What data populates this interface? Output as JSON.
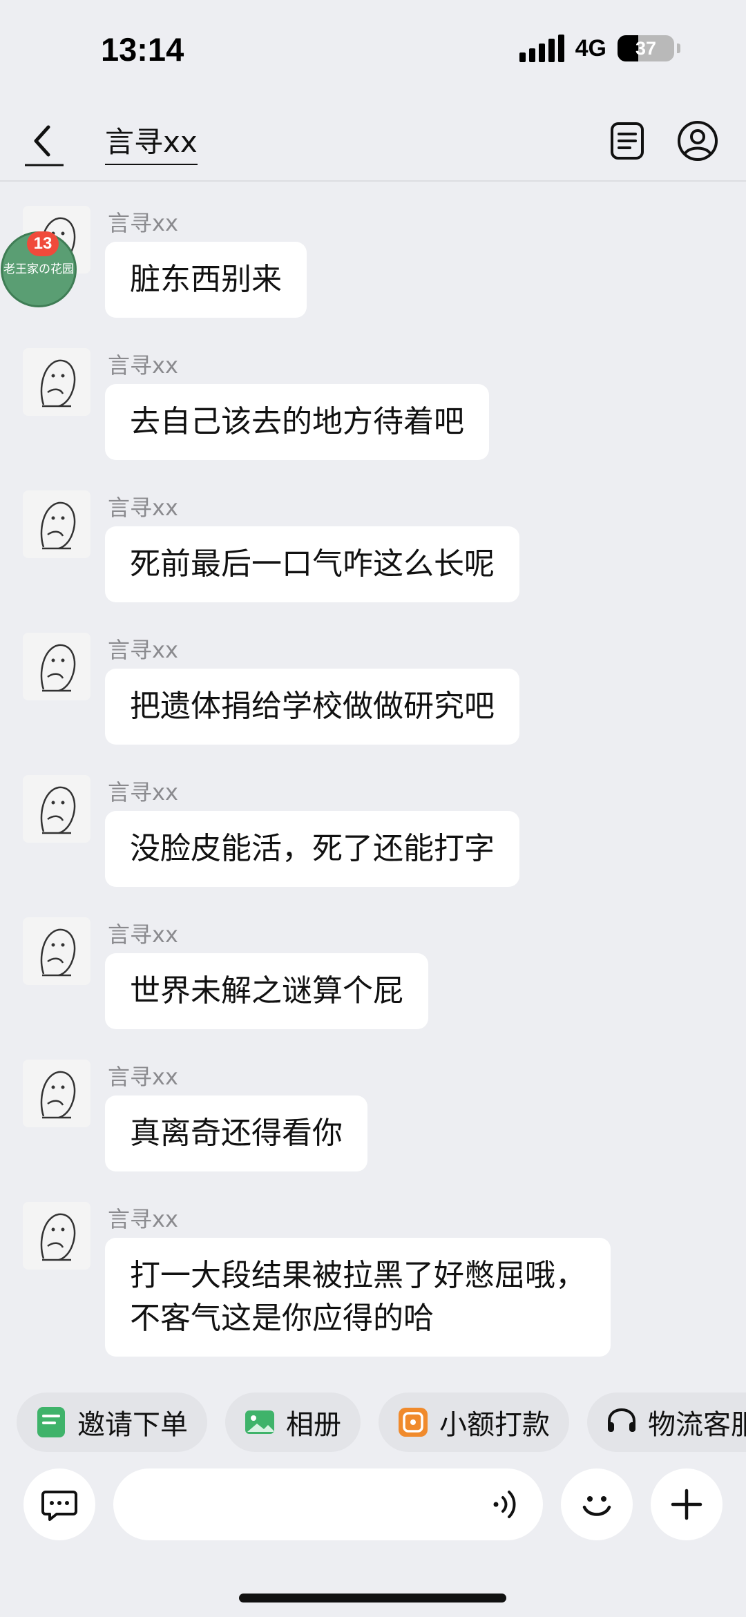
{
  "status_bar": {
    "time": "13:14",
    "network": "4G",
    "battery": "37",
    "battery_level": 0.37
  },
  "nav": {
    "title": "言寻xx",
    "back_icon": "chevron-left-icon",
    "order_icon": "document-list-icon",
    "profile_icon": "user-circle-icon"
  },
  "floating_widget": {
    "badge_count": "13",
    "label": "老王家の花园"
  },
  "messages": [
    {
      "sender": "言寻xx",
      "text": "脏东西别来"
    },
    {
      "sender": "言寻xx",
      "text": "去自己该去的地方待着吧"
    },
    {
      "sender": "言寻xx",
      "text": "死前最后一口气咋这么长呢"
    },
    {
      "sender": "言寻xx",
      "text": "把遗体捐给学校做做研究吧"
    },
    {
      "sender": "言寻xx",
      "text": "没脸皮能活，死了还能打字"
    },
    {
      "sender": "言寻xx",
      "text": "世界未解之谜算个屁"
    },
    {
      "sender": "言寻xx",
      "text": "真离奇还得看你"
    },
    {
      "sender": "言寻xx",
      "text": "打一大段结果被拉黑了好憋屈哦，\n不客气这是你应得的哈"
    }
  ],
  "quick_actions": [
    {
      "label": "邀请下单",
      "icon": "order-icon",
      "color": "#3fb36a"
    },
    {
      "label": "相册",
      "icon": "image-icon",
      "color": "#3fb36a"
    },
    {
      "label": "小额打款",
      "icon": "payment-icon",
      "color": "#f08a2c"
    },
    {
      "label": "物流客服",
      "icon": "headset-icon",
      "color": "#111111"
    }
  ],
  "input": {
    "placeholder": "",
    "value": ""
  }
}
